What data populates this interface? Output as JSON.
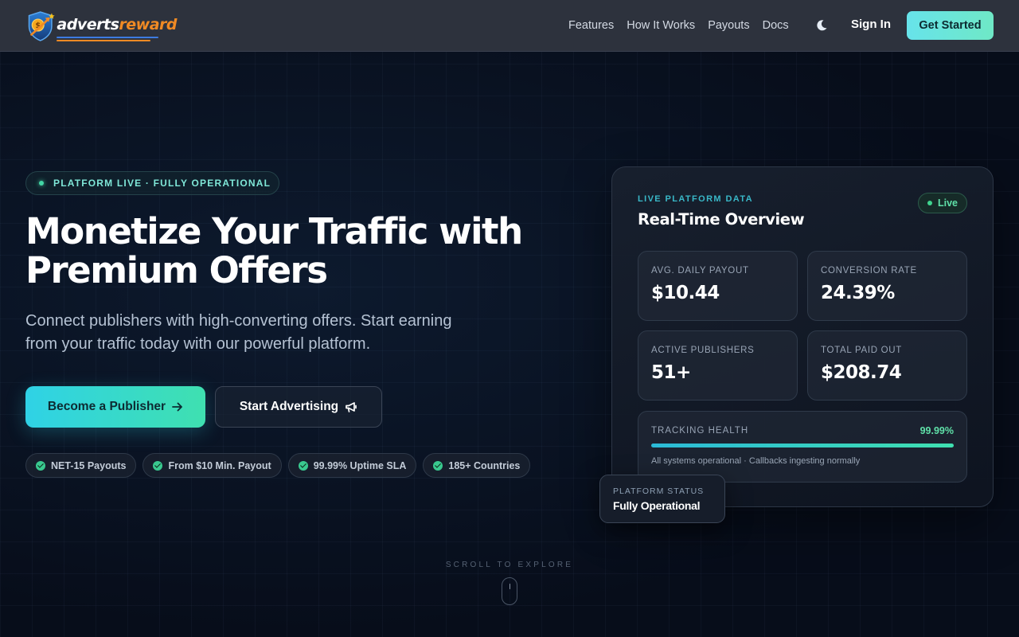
{
  "brand": {
    "name_part1": "adverts",
    "name_part2": "reward",
    "icon": "shield-dollar-logo"
  },
  "nav": {
    "links": [
      "Features",
      "How It Works",
      "Payouts",
      "Docs"
    ],
    "theme_icon": "moon-icon",
    "sign_in": "Sign In",
    "get_started": "Get Started"
  },
  "hero": {
    "status_pill": "PLATFORM LIVE · FULLY OPERATIONAL",
    "headline_line1": "Monetize Your Traffic with",
    "headline_line2": "Premium Offers",
    "subtitle": "Connect publishers with high-converting offers. Start earning from your traffic today with our powerful platform.",
    "primary_cta": "Become a Publisher",
    "primary_cta_icon": "arrow-right-icon",
    "secondary_cta": "Start Advertising",
    "secondary_cta_icon": "megaphone-icon",
    "chips": [
      "NET-15 Payouts",
      "From $10 Min. Payout",
      "99.99% Uptime SLA",
      "185+ Countries"
    ]
  },
  "overview": {
    "kicker": "LIVE PLATFORM DATA",
    "title": "Real-Time Overview",
    "live_label": "Live",
    "stats": [
      {
        "label": "AVG. DAILY PAYOUT",
        "value": "$10.44"
      },
      {
        "label": "CONVERSION RATE",
        "value": "24.39%"
      },
      {
        "label": "ACTIVE PUBLISHERS",
        "value": "51+"
      },
      {
        "label": "TOTAL PAID OUT",
        "value": "$208.74"
      }
    ],
    "health": {
      "label": "TRACKING HEALTH",
      "percent_text": "99.99%",
      "percent": 99.99,
      "note": "All systems operational · Callbacks ingesting normally"
    },
    "platform_status": {
      "label": "PLATFORM STATUS",
      "value": "Fully Operational"
    }
  },
  "scroll_hint": "SCROLL TO EXPLORE",
  "colors": {
    "accent_cyan": "#2fd2e6",
    "accent_green": "#3fe0b0",
    "brand_orange": "#f08a24",
    "header_bg": "#2d323d",
    "page_bg": "#070d1a"
  }
}
